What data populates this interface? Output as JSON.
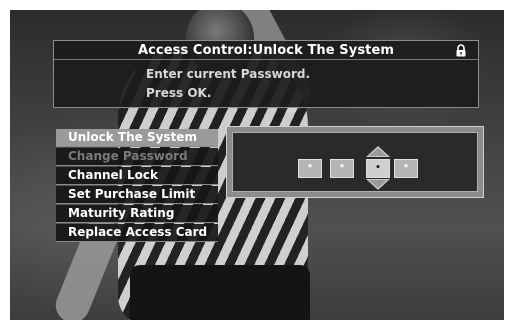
{
  "header": {
    "title": "Access Control:Unlock The System",
    "lock_icon": "lock-icon",
    "instructions": [
      "Enter current Password.",
      "Press OK."
    ]
  },
  "menu": {
    "items": [
      {
        "label": "Unlock The System",
        "state": "selected"
      },
      {
        "label": "Change Password",
        "state": "disabled"
      },
      {
        "label": "Channel Lock",
        "state": "normal"
      },
      {
        "label": "Set Purchase Limit",
        "state": "normal"
      },
      {
        "label": "Maturity Rating",
        "state": "normal"
      },
      {
        "label": "Replace Access Card",
        "state": "normal"
      }
    ]
  },
  "password": {
    "digits": [
      "*",
      "*",
      "•",
      "*"
    ],
    "active_index": 2,
    "up_icon": "arrow-up-icon",
    "down_icon": "arrow-down-icon"
  },
  "colors": {
    "panel_bg": "#1c1c1c",
    "selected_bg": "#9a9a9a",
    "disabled_text": "#7a7a7a",
    "text": "#ffffff"
  }
}
